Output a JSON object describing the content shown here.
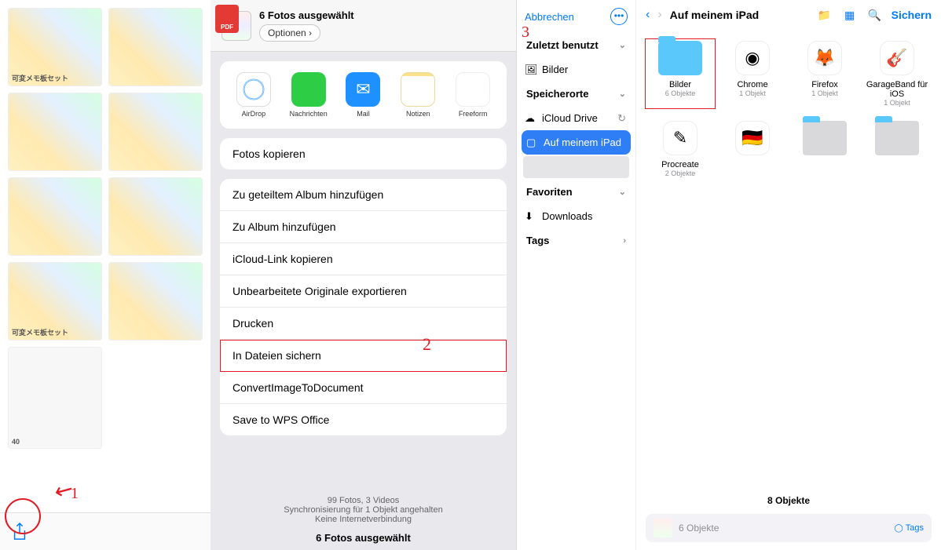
{
  "panel1": {
    "thumbs": [
      "可変メモ板セット",
      "",
      "",
      "",
      "",
      "",
      "可変メモ板セット",
      "",
      "40"
    ],
    "annotation": "1"
  },
  "share": {
    "title": "6 Fotos ausgewählt",
    "options": "Optionen",
    "apps": [
      {
        "k": "airdrop",
        "label": "AirDrop"
      },
      {
        "k": "msg",
        "label": "Nachrichten"
      },
      {
        "k": "mail",
        "label": "Mail"
      },
      {
        "k": "notes",
        "label": "Notizen"
      },
      {
        "k": "freeform",
        "label": "Freeform"
      }
    ],
    "actions": [
      "Fotos kopieren",
      "Zu geteiltem Album hinzufügen",
      "Zu Album hinzufügen",
      "iCloud-Link kopieren",
      "Unbearbeitete Originale exportieren",
      "Drucken",
      "In Dateien sichern",
      "ConvertImageToDocument",
      "Save to WPS Office"
    ],
    "hl_index": 6,
    "footer_line1": "99 Fotos, 3 Videos",
    "footer_line2": "Synchronisierung für 1 Objekt angehalten",
    "footer_line3": "Keine Internetverbindung",
    "footer_bold": "6 Fotos ausgewählt",
    "annotation": "2",
    "pdf_badge": "PDF"
  },
  "sidebar": {
    "cancel": "Abbrechen",
    "sections": {
      "recent": {
        "label": "Zuletzt benutzt",
        "items": [
          {
            "label": "Bilder",
            "ic": "🖼"
          }
        ]
      },
      "locations": {
        "label": "Speicherorte",
        "items": [
          {
            "label": "iCloud Drive",
            "ic": "☁︎",
            "trail": "↻"
          },
          {
            "label": "Auf meinem iPad",
            "ic": "▢",
            "sel": true
          }
        ]
      },
      "favorites": {
        "label": "Favoriten",
        "items": [
          {
            "label": "Downloads",
            "ic": "⬇︎"
          }
        ]
      },
      "tags": {
        "label": "Tags"
      }
    },
    "annotation": "3"
  },
  "files": {
    "title": "Auf meinem iPad",
    "save": "Sichern",
    "items": [
      {
        "name": "Bilder",
        "sub": "6 Objekte",
        "type": "f",
        "hl": true
      },
      {
        "name": "Chrome",
        "sub": "1 Objekt",
        "type": "a",
        "glyph": "◉"
      },
      {
        "name": "Firefox",
        "sub": "1 Objekt",
        "type": "a",
        "glyph": "🦊"
      },
      {
        "name": "GarageBand für iOS",
        "sub": "1 Objekt",
        "type": "a",
        "glyph": "🎸"
      },
      {
        "name": "Procreate",
        "sub": "2 Objekte",
        "type": "a",
        "glyph": "✎"
      },
      {
        "name": "",
        "sub": "",
        "type": "a",
        "glyph": "🇩🇪"
      },
      {
        "name": "",
        "sub": "",
        "type": "f",
        "gray": true
      },
      {
        "name": "",
        "sub": "",
        "type": "f",
        "gray": true
      }
    ],
    "count": "8 Objekte",
    "footer_text": "6 Objekte",
    "tags": "Tags"
  }
}
